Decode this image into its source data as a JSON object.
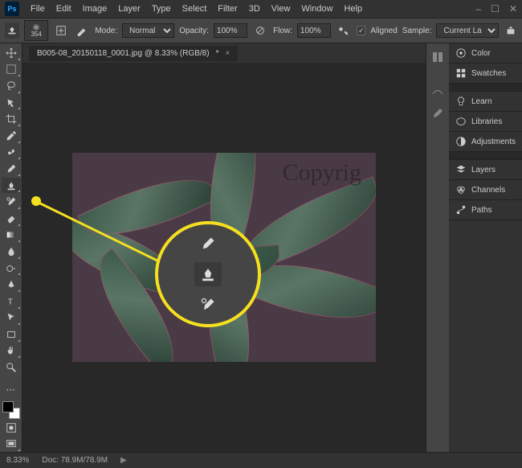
{
  "app": {
    "logo": "Ps"
  },
  "menu": [
    "File",
    "Edit",
    "Image",
    "Layer",
    "Type",
    "Select",
    "Filter",
    "3D",
    "View",
    "Window",
    "Help"
  ],
  "window_controls": [
    "–",
    "☐",
    "✕"
  ],
  "options": {
    "brush_size": "354",
    "mode_label": "Mode:",
    "mode_value": "Normal",
    "opacity_label": "Opacity:",
    "opacity_value": "100%",
    "flow_label": "Flow:",
    "flow_value": "100%",
    "aligned_checked": true,
    "aligned_label": "Aligned",
    "sample_label": "Sample:",
    "sample_value": "Current Layer"
  },
  "document": {
    "tab_title": "B005-08_20150118_0001.jpg @ 8.33% (RGB/8)",
    "tab_modified": "*",
    "watermark": "Copyrig"
  },
  "panels": {
    "color": "Color",
    "swatches": "Swatches",
    "learn": "Learn",
    "libraries": "Libraries",
    "adjustments": "Adjustments",
    "layers": "Layers",
    "channels": "Channels",
    "paths": "Paths"
  },
  "status": {
    "zoom": "8.33%",
    "doc_label": "Doc:",
    "doc_value": "78.9M/78.9M"
  },
  "highlight": {
    "tool": "clone-stamp"
  }
}
